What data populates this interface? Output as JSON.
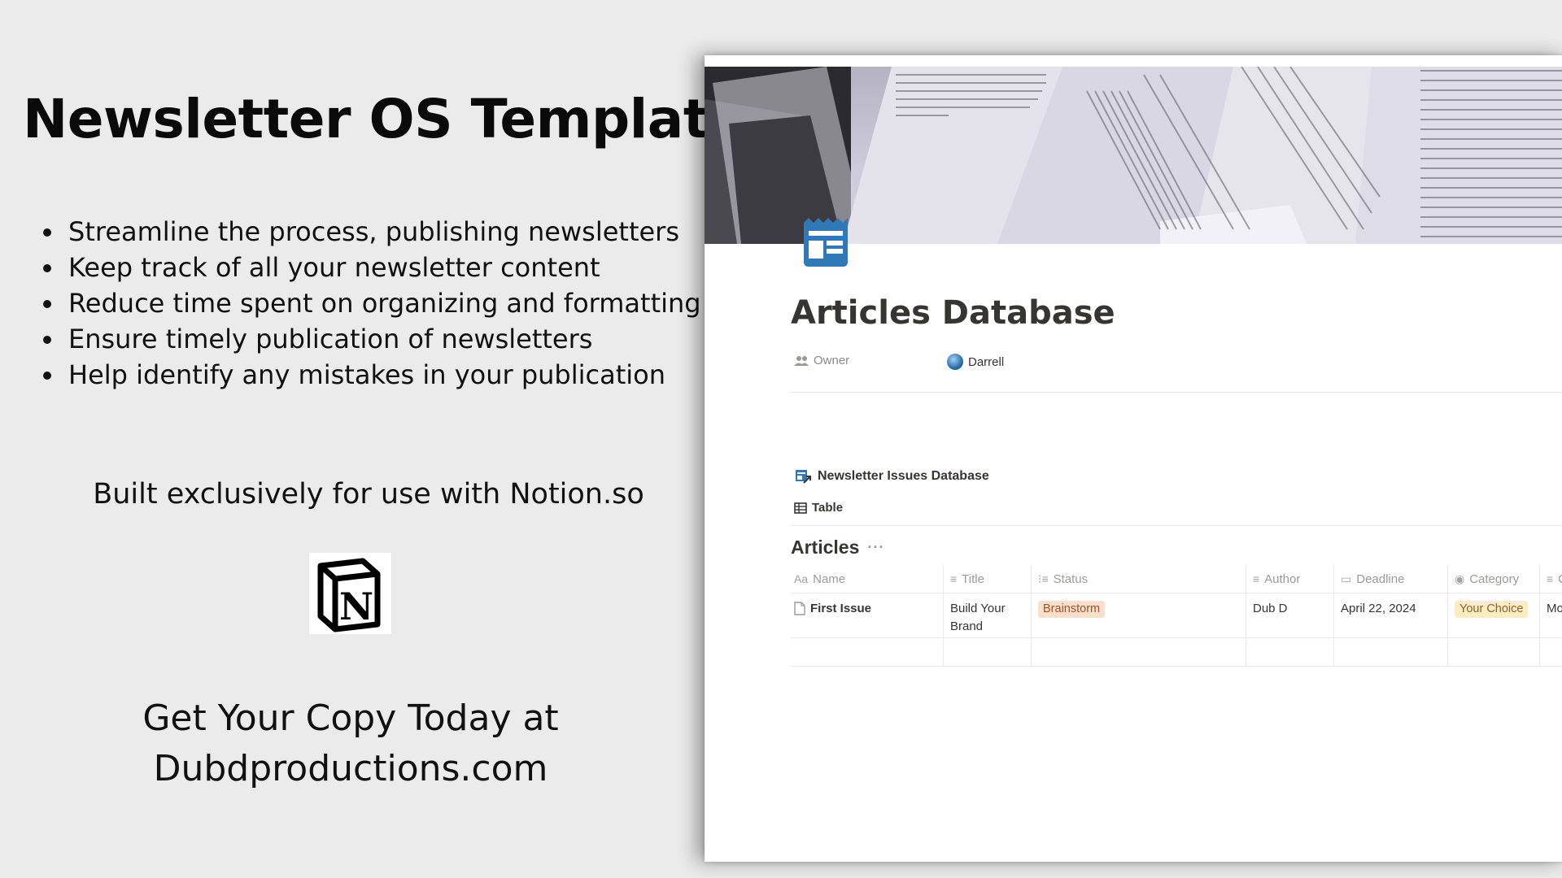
{
  "promo": {
    "title": "Newsletter OS Template",
    "benefits": [
      "Streamline the process, publishing newsletters",
      "Keep track of all your newsletter content",
      "Reduce time spent on organizing and formatting",
      "Ensure timely publication of newsletters",
      "Help identify any mistakes in your publication"
    ],
    "built_for": "Built exclusively for use with Notion.so",
    "logo_letter": "N",
    "cta_line1": "Get Your Copy Today at",
    "cta_line2": "Dubdproductions.com"
  },
  "notion": {
    "page_icon": "newspaper-icon",
    "title": "Articles Database",
    "properties": [
      {
        "name": "Owner",
        "icon": "people-icon",
        "value": "Darrell",
        "value_icon": "globe-avatar"
      }
    ],
    "linked_page": {
      "label": "Newsletter Issues Database",
      "icon": "linked-database-icon"
    },
    "view": {
      "label": "Table",
      "icon": "table-icon"
    },
    "database": {
      "title": "Articles",
      "more": "···",
      "columns": [
        {
          "label": "Name",
          "icon_text": "Aa"
        },
        {
          "label": "Title",
          "icon_text": "≡"
        },
        {
          "label": "Status",
          "icon_text": "⁝≡"
        },
        {
          "label": "Author",
          "icon_text": "≡"
        },
        {
          "label": "Deadline",
          "icon_text": "▭"
        },
        {
          "label": "Category",
          "icon_text": "◉"
        },
        {
          "label": "C",
          "icon_text": "≡"
        }
      ],
      "rows": [
        {
          "name": "First Issue",
          "title": "Build Your Brand",
          "status": "Brainstorm",
          "author": "Dub D",
          "deadline": "April 22, 2024",
          "category": "Your Choice",
          "more": "Mor"
        }
      ]
    },
    "colors": {
      "status_tag_bg": "#fbdecb",
      "category_tag_bg": "#fbecc4",
      "page_icon": "#2e7ab8"
    }
  }
}
